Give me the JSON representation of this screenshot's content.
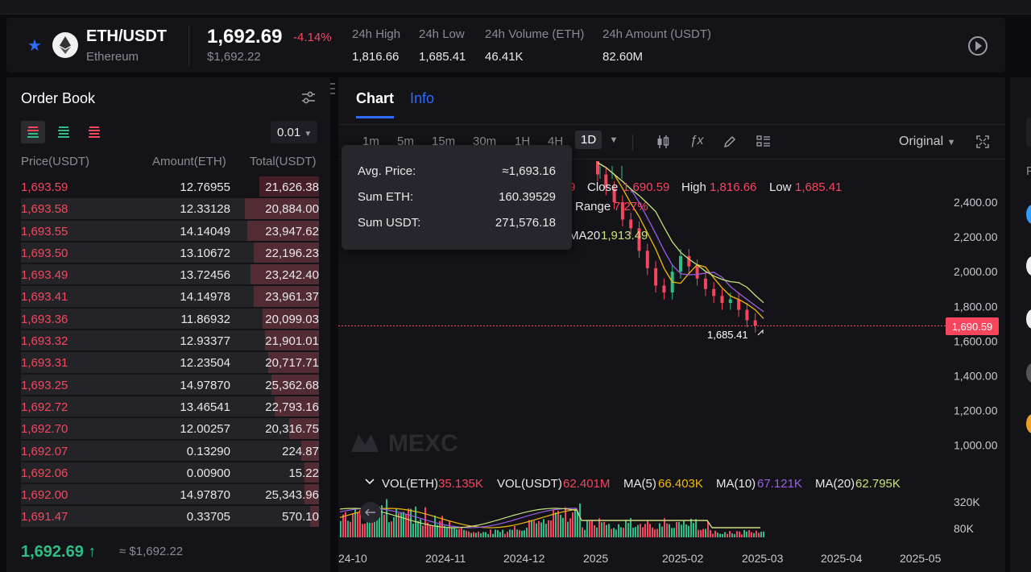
{
  "ticker": {
    "pair": "ETH/USDT",
    "name": "Ethereum",
    "last_price": "1,692.69",
    "change_pct": "-4.14%",
    "usd_value": "$1,692.22",
    "stats": [
      {
        "label": "24h High",
        "value": "1,816.66"
      },
      {
        "label": "24h Low",
        "value": "1,685.41"
      },
      {
        "label": "24h Volume (ETH)",
        "value": "46.41K"
      },
      {
        "label": "24h Amount (USDT)",
        "value": "82.60M"
      }
    ]
  },
  "order_book": {
    "title": "Order Book",
    "precision": "0.01",
    "headers": {
      "price": "Price(USDT)",
      "amount": "Amount(ETH)",
      "total": "Total(USDT)"
    },
    "rows": [
      {
        "price": "1,693.59",
        "amount": "12.76955",
        "total": "21,626.38",
        "depth": 0.2
      },
      {
        "price": "1,693.58",
        "amount": "12.33128",
        "total": "20,884.00",
        "depth": 0.25
      },
      {
        "price": "1,693.55",
        "amount": "14.14049",
        "total": "23,947.62",
        "depth": 0.24
      },
      {
        "price": "1,693.50",
        "amount": "13.10672",
        "total": "22,196.23",
        "depth": 0.22
      },
      {
        "price": "1,693.49",
        "amount": "13.72456",
        "total": "23,242.40",
        "depth": 0.23
      },
      {
        "price": "1,693.41",
        "amount": "14.14978",
        "total": "23,961.37",
        "depth": 0.22
      },
      {
        "price": "1,693.36",
        "amount": "11.86932",
        "total": "20,099.03",
        "depth": 0.19
      },
      {
        "price": "1,693.32",
        "amount": "12.93377",
        "total": "21,901.01",
        "depth": 0.18
      },
      {
        "price": "1,693.31",
        "amount": "12.23504",
        "total": "20,717.71",
        "depth": 0.17
      },
      {
        "price": "1,693.25",
        "amount": "14.97870",
        "total": "25,362.68",
        "depth": 0.16
      },
      {
        "price": "1,692.72",
        "amount": "13.46541",
        "total": "22,793.16",
        "depth": 0.15
      },
      {
        "price": "1,692.70",
        "amount": "12.00257",
        "total": "20,316.75",
        "depth": 0.1
      },
      {
        "price": "1,692.07",
        "amount": "0.13290",
        "total": "224.87",
        "depth": 0.06
      },
      {
        "price": "1,692.06",
        "amount": "0.00900",
        "total": "15.22",
        "depth": 0.05
      },
      {
        "price": "1,692.00",
        "amount": "14.97870",
        "total": "25,343.96",
        "depth": 0.05
      },
      {
        "price": "1,691.47",
        "amount": "0.33705",
        "total": "570.10",
        "depth": 0.03
      }
    ],
    "footer_price": "1,692.69",
    "footer_arrow": "↑",
    "footer_usd": "≈ $1,692.22"
  },
  "chart_tabs": [
    "Chart",
    "Info"
  ],
  "intervals": [
    "1m",
    "5m",
    "15m",
    "30m",
    "1H",
    "4H",
    "1D"
  ],
  "active_interval": "1D",
  "price_mode": "Original",
  "tooltip": {
    "avg_label": "Avg. Price:",
    "avg_value": "≈1,693.16",
    "eth_label": "Sum ETH:",
    "eth_value": "160.39529",
    "usdt_label": "Sum USDT:",
    "usdt_value": "271,576.18"
  },
  "ohlc": {
    "open_value_partial": "9",
    "close_label": "Close",
    "close_value": "1,690.59",
    "high_label": "High",
    "high_value": "1,816.66",
    "low_label": "Low",
    "low_value": "1,685.41",
    "range_label": "Range",
    "range_value": "7.27%",
    "ma20_label": "MA20",
    "ma20_value": "1,913.49"
  },
  "watermark": "MEXC",
  "volume": {
    "vol_eth_label": "VOL(ETH)",
    "vol_eth_value": "35.135K",
    "vol_usdt_label": "VOL(USDT)",
    "vol_usdt_value": "62.401M",
    "ma5_label": "MA(5)",
    "ma5_value": "66.403K",
    "ma10_label": "MA(10)",
    "ma10_value": "67.121K",
    "ma20_label": "MA(20)",
    "ma20_value": "62.795K",
    "y_ticks": [
      "320K",
      "80K"
    ]
  },
  "chart_data": {
    "type": "candlestick",
    "y_ticks": [
      "2,400.00",
      "2,200.00",
      "2,000.00",
      "1,800.00",
      "1,600.00",
      "1,400.00",
      "1,200.00",
      "1,000.00"
    ],
    "x_ticks": [
      "24-10",
      "2024-11",
      "2024-12",
      "2025",
      "2025-02",
      "2025-03",
      "2025-04",
      "2025-05"
    ],
    "current_price_label": "1,690.59",
    "low_marker": "1,685.41",
    "recent_close_path": [
      2640,
      2560,
      2480,
      2400,
      2300,
      2250,
      2120,
      2020,
      1920,
      1880,
      2000,
      2090,
      2030,
      1960,
      1900,
      1860,
      1820,
      1840,
      1780,
      1720,
      1690
    ],
    "colors": {
      "up": "#2ebd85",
      "down": "#f6465d",
      "ma5": "#f0b90b",
      "ma10": "#9b5de5",
      "ma20": "#c5e478"
    }
  }
}
